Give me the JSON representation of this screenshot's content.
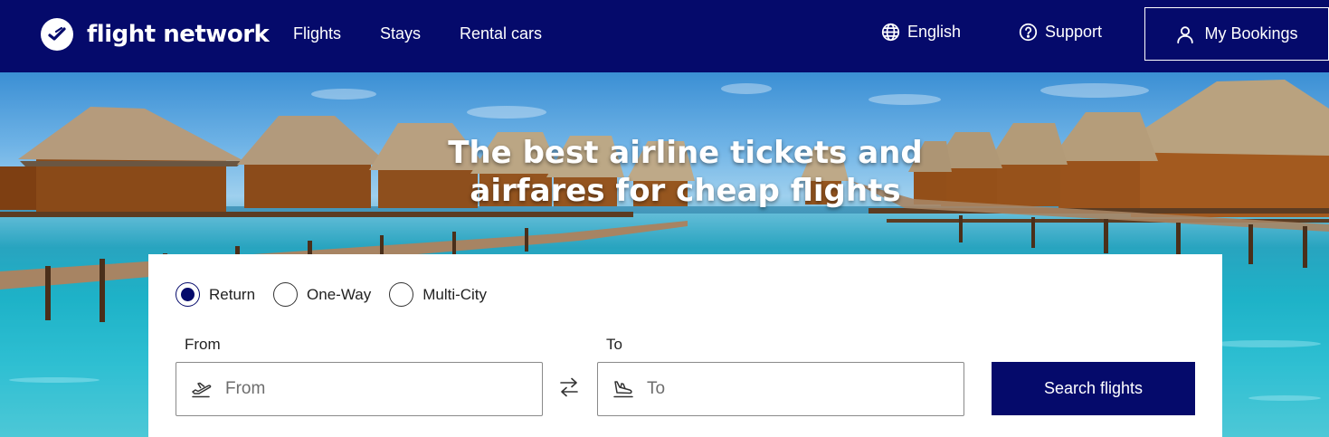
{
  "brand": {
    "name": "flight network",
    "logo_icon": "plane-check-icon"
  },
  "nav": [
    {
      "label": "Flights"
    },
    {
      "label": "Stays"
    },
    {
      "label": "Rental cars"
    }
  ],
  "header_right": {
    "language": {
      "label": "English",
      "icon": "globe-icon"
    },
    "support": {
      "label": "Support",
      "icon": "help-circle-icon"
    },
    "bookings": {
      "label": "My Bookings",
      "icon": "user-icon"
    }
  },
  "hero": {
    "title_line1": "The best airline tickets and",
    "title_line2": "airfares for cheap flights"
  },
  "search": {
    "trip_types": [
      {
        "label": "Return",
        "selected": true
      },
      {
        "label": "One-Way",
        "selected": false
      },
      {
        "label": "Multi-City",
        "selected": false
      }
    ],
    "from": {
      "label": "From",
      "placeholder": "From",
      "value": "",
      "icon": "plane-takeoff-icon"
    },
    "to": {
      "label": "To",
      "placeholder": "To",
      "value": "",
      "icon": "plane-landing-icon"
    },
    "swap_icon": "swap-arrows-icon",
    "submit_label": "Search flights"
  },
  "colors": {
    "brand_navy": "#050a6b",
    "white": "#ffffff"
  }
}
